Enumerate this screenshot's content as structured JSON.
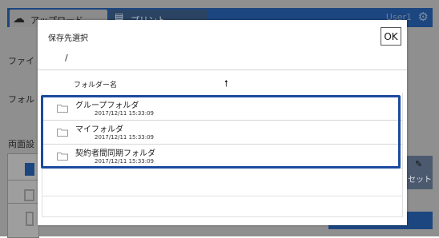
{
  "background": {
    "tabs": [
      {
        "label": "アップロード",
        "icon": "cloud-upload-icon"
      },
      {
        "label": "プリント",
        "icon": "printer-icon"
      }
    ],
    "user": "User1",
    "settings_icon": "gear-icon",
    "left_labels": [
      "ファイ",
      "フォル",
      "両面設"
    ],
    "right_button_label": "セット"
  },
  "dialog": {
    "title": "保存先選択",
    "path": "/",
    "ok_label": "OK",
    "column_header": "フォルダー名",
    "sort_icon": "arrow-up-icon",
    "folders": [
      {
        "name": "グループフォルダ",
        "date": "2017/12/11 15:33:09"
      },
      {
        "name": "マイフォルダ",
        "date": "2017/12/11 15:33:09"
      },
      {
        "name": "契約者間同期フォルダ",
        "date": "2017/12/11 15:33:09"
      }
    ],
    "highlight_color": "#1b4b9e"
  }
}
